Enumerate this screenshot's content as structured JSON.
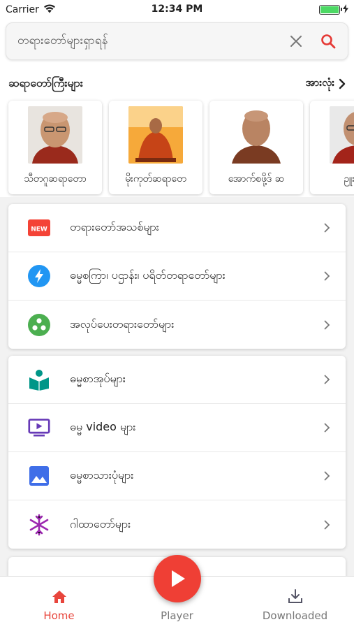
{
  "status_bar": {
    "carrier": "Carrier",
    "time": "12:34 PM",
    "battery_level": 1.0
  },
  "search": {
    "text": "တရားတော်များရှာရန်",
    "clear_icon": "close-icon",
    "search_icon": "search-icon"
  },
  "teachers_section": {
    "title": "ဆရာတော်ကြီးများ",
    "see_all_label": "အားလုံး",
    "items": [
      {
        "name": "သီတဂူဆရာတော"
      },
      {
        "name": "မိုးကုတ်ဆရာတေ"
      },
      {
        "name": "အောက်စဖို့ဒ် ဆ"
      },
      {
        "name": "ဥူးသုမ"
      }
    ]
  },
  "menu_group_1": [
    {
      "label": "တရားတော်အသစ်များ",
      "icon": "new-badge-icon",
      "icon_text": "NEW",
      "color": "#f44336"
    },
    {
      "label": "ဓမ္မစကြာ၊ ပဌာန်း၊ ပရိတ်တရာတော်များ",
      "icon": "lightning-icon",
      "color": "#2196f3"
    },
    {
      "label": "အလုပ်ပေးတရားတော်များ",
      "icon": "group-circles-icon",
      "color": "#4caf50"
    }
  ],
  "menu_group_2": [
    {
      "label": "ဓမ္မစာအုပ်များ",
      "icon": "book-reader-icon",
      "color": "#009688"
    },
    {
      "label": "ဓမ္မ video များ",
      "icon": "video-icon",
      "color": "#673ab7"
    },
    {
      "label": "ဓမ္မစာသားပုံများ",
      "icon": "image-icon",
      "color": "#3f6ee8"
    },
    {
      "label": "ဂါထာတော်များ",
      "icon": "snowflake-icon",
      "color": "#9c27b0"
    }
  ],
  "tab_bar": {
    "home_label": "Home",
    "player_label": "Player",
    "downloaded_label": "Downloaded",
    "accent": "#e8453c",
    "fab_color": "#ef3f35"
  }
}
